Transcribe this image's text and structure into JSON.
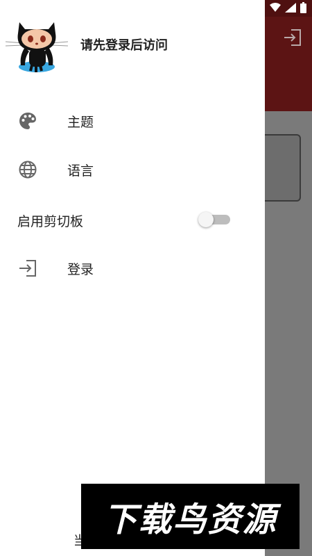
{
  "drawer": {
    "header_text": "请先登录后访问",
    "items": [
      {
        "label": "主题",
        "icon": "palette-icon"
      },
      {
        "label": "语言",
        "icon": "globe-icon"
      },
      {
        "label": "登录",
        "icon": "login-icon"
      }
    ],
    "clipboard_switch": {
      "label": "启用剪切板",
      "on": false
    },
    "footer_text": "当"
  },
  "watermark": {
    "text": "下载鸟资源"
  },
  "colors": {
    "appbar": "#5c1414",
    "scrim": "#7a7a7a",
    "drawer": "#ffffff"
  }
}
